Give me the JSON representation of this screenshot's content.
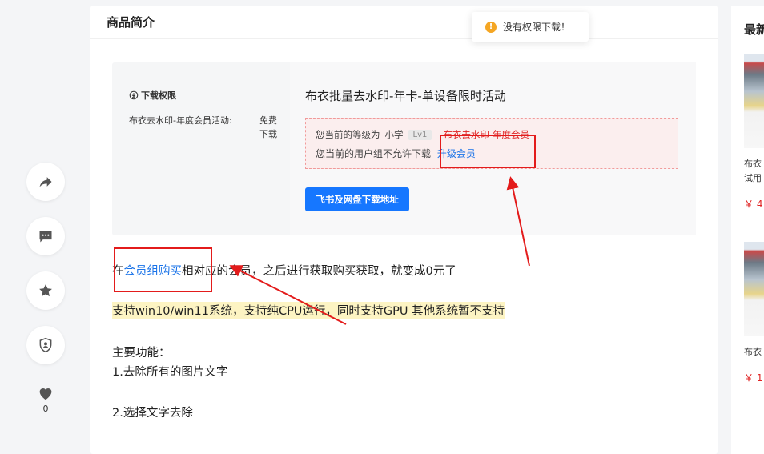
{
  "product": {
    "section_title": "商品简介"
  },
  "download_box": {
    "permission_title": "下载权限",
    "permission_name": "布衣去水印-年度会员活动:",
    "permission_value": "免费下载",
    "title": "布衣批量去水印-年卡-单设备限时活动",
    "current_level_label": "您当前的等级为",
    "current_level_name": "小学",
    "current_level_badge": "Lv1",
    "required_group": "布衣去水印-年度会员",
    "group_notice": "您当前的用户组不允许下载",
    "upgrade_link": "升级会员",
    "download_button": "飞书及网盘下载地址"
  },
  "content": {
    "p1_prefix": "在",
    "p1_link": "会员组购买",
    "p1_suffix": "相对应的会员，之后进行获取购买获取，就变成0元了",
    "p2": "支持win10/win11系统，支持纯CPU运行，同时支持GPU 其他系统暂不支持",
    "p3": "主要功能：",
    "p4": "1.去除所有的图片文字",
    "p5": "2.选择文字去除"
  },
  "toast": {
    "icon": "!",
    "message": "没有权限下载！"
  },
  "side_actions": {
    "like_count": "0"
  },
  "right_panel": {
    "title": "最新",
    "item1_text_a": "布衣",
    "item1_text_b": "试用",
    "item1_price": "￥ 4",
    "item2_text": "布衣",
    "item2_price": "￥ 1"
  },
  "colors": {
    "accent_blue": "#1677ff",
    "link_blue": "#1a73e8",
    "annotation_red": "#e31b1b",
    "warning_orange": "#f5a623"
  },
  "icons": [
    "share-icon",
    "comment-icon",
    "star-icon",
    "shield-user-icon",
    "heart-icon",
    "download-circle-icon",
    "warning-icon"
  ]
}
